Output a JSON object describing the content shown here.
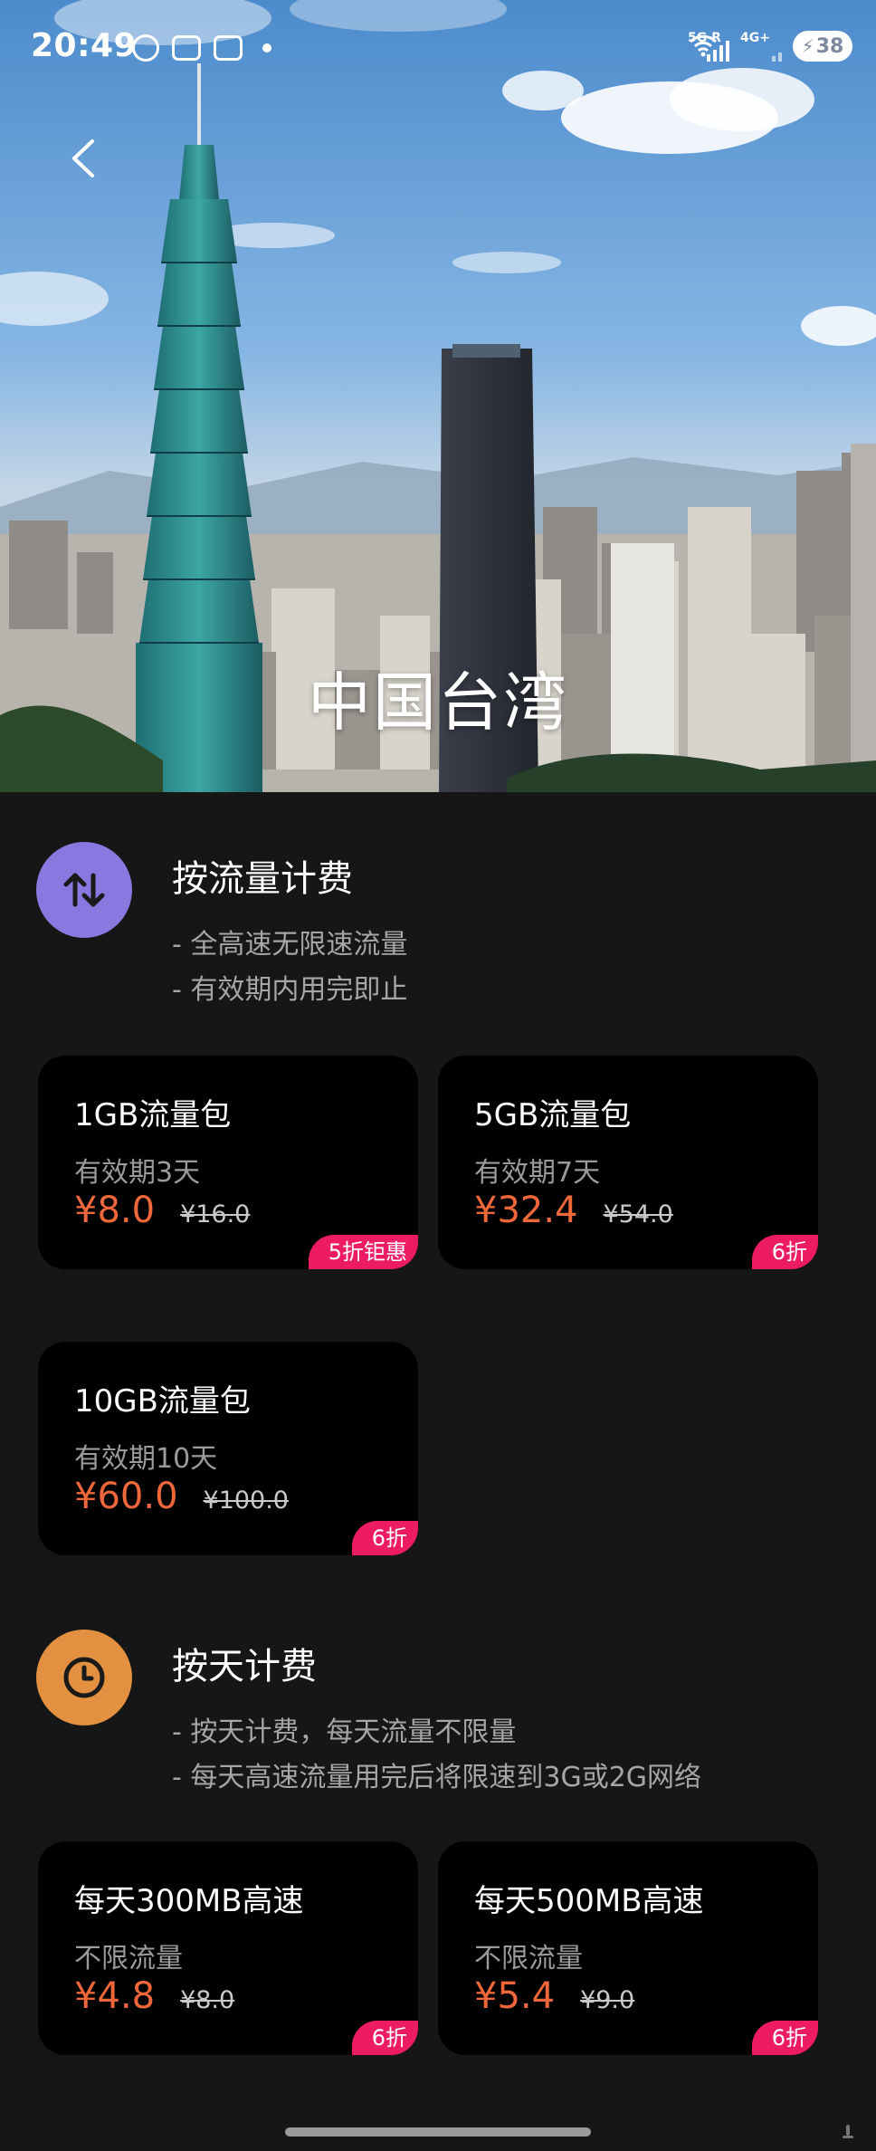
{
  "status_bar": {
    "time": "20:49",
    "net_tag_1": "5G R",
    "net_tag_2": "4G+",
    "battery": "38"
  },
  "hero": {
    "title": "中国台湾"
  },
  "sections": [
    {
      "title": "按流量计费",
      "icon": "up-down-arrows-icon",
      "icon_color": "#8a78e0",
      "desc": [
        "- 全高速无限速流量",
        "- 有效期内用完即止"
      ],
      "cards": [
        {
          "name": "1GB流量包",
          "sub": "有效期3天",
          "price": "¥8.0",
          "orig": "¥16.0",
          "badge": "5折钜惠"
        },
        {
          "name": "5GB流量包",
          "sub": "有效期7天",
          "price": "¥32.4",
          "orig": "¥54.0",
          "badge": "6折"
        },
        {
          "name": "10GB流量包",
          "sub": "有效期10天",
          "price": "¥60.0",
          "orig": "¥100.0",
          "badge": "6折"
        }
      ]
    },
    {
      "title": "按天计费",
      "icon": "clock-icon",
      "icon_color": "#e39140",
      "desc": [
        "- 按天计费，每天流量不限量",
        "- 每天高速流量用完后将限速到3G或2G网络"
      ],
      "cards": [
        {
          "name": "每天300MB高速",
          "sub": "不限流量",
          "price": "¥4.8",
          "orig": "¥8.0",
          "badge": "6折"
        },
        {
          "name": "每天500MB高速",
          "sub": "不限流量",
          "price": "¥5.4",
          "orig": "¥9.0",
          "badge": "6折"
        }
      ]
    }
  ],
  "colors": {
    "page_bg": "#161616",
    "card_bg": "#000000",
    "price": "#f0673a",
    "badge": "#ec1b64",
    "muted_text": "#a6a6a6"
  }
}
